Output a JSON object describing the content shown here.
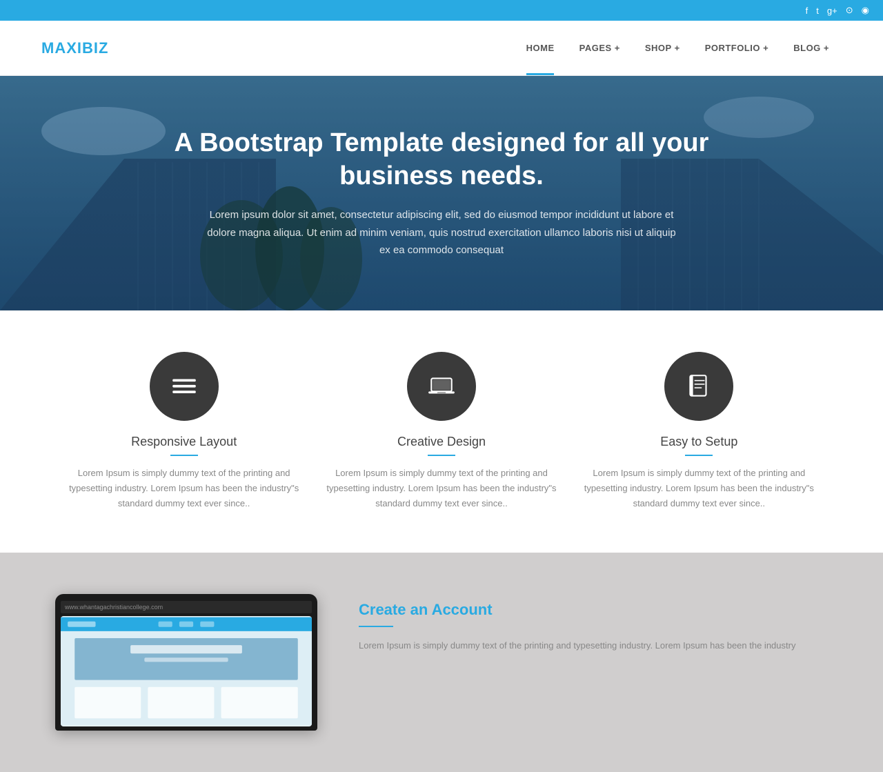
{
  "topbar": {
    "icons": [
      "facebook",
      "twitter",
      "google-plus",
      "dribbble",
      "rss"
    ]
  },
  "header": {
    "logo_text": "MAXI",
    "logo_accent": "BIZ",
    "nav_items": [
      {
        "label": "HOME",
        "active": true
      },
      {
        "label": "PAGES +",
        "active": false
      },
      {
        "label": "SHOP +",
        "active": false
      },
      {
        "label": "PORTFOLIO +",
        "active": false
      },
      {
        "label": "BLOG +",
        "active": false
      }
    ]
  },
  "hero": {
    "title": "A Bootstrap Template designed for all your business needs.",
    "subtitle": "Lorem ipsum dolor sit amet, consectetur adipiscing elit, sed do eiusmod tempor incididunt ut labore et dolore magna aliqua. Ut enim ad minim veniam, quis nostrud exercitation ullamco laboris nisi ut aliquip ex ea commodo consequat"
  },
  "features": [
    {
      "title": "Responsive Layout",
      "icon": "menu",
      "desc": "Lorem Ipsum is simply dummy text of the printing and typesetting industry. Lorem Ipsum has been the industry\"s standard dummy text ever since.."
    },
    {
      "title": "Creative Design",
      "icon": "laptop",
      "desc": "Lorem Ipsum is simply dummy text of the printing and typesetting industry. Lorem Ipsum has been the industry\"s standard dummy text ever since.."
    },
    {
      "title": "Easy to Setup",
      "icon": "book",
      "desc": "Lorem Ipsum is simply dummy text of the printing and typesetting industry. Lorem Ipsum has been the industry\"s standard dummy text ever since.."
    }
  ],
  "cta": {
    "title": "Create an Account",
    "desc": "Lorem Ipsum is simply dummy text of the printing and typesetting industry. Lorem Ipsum has been the industry",
    "device_url": "www.whantagachristiancollege.com"
  }
}
